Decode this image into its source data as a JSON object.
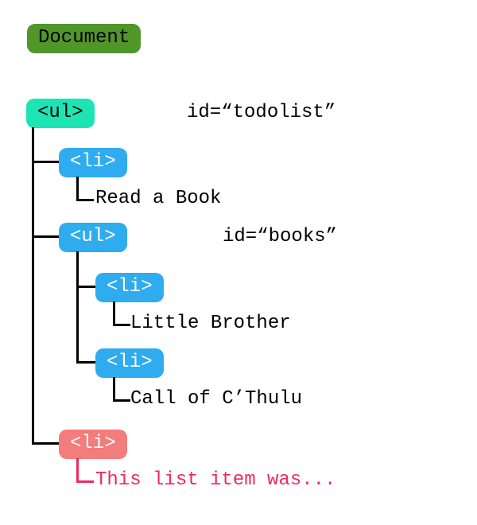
{
  "root": {
    "label": "Document"
  },
  "ul1": {
    "tag": "<ul>",
    "attr": "id=“todolist”"
  },
  "li1": {
    "tag": "<li>",
    "text": "Read a Book"
  },
  "ul2": {
    "tag": "<ul>",
    "attr": "id=“books”"
  },
  "li2": {
    "tag": "<li>",
    "text": "Little Brother"
  },
  "li3": {
    "tag": "<li>",
    "text": "Call of C’Thulu"
  },
  "li4": {
    "tag": "<li>",
    "text": "This list item was..."
  }
}
